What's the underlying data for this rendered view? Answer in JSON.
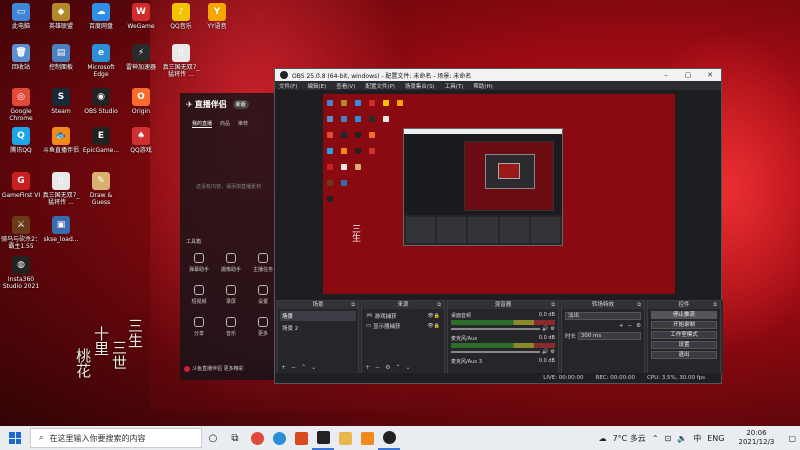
{
  "desktop": {
    "icons": [
      {
        "label": "此电脑",
        "color": "#3f86d6",
        "glyph": "▭"
      },
      {
        "label": "英雄联盟",
        "color": "#b08a2a",
        "glyph": "◆"
      },
      {
        "label": "百度网盘",
        "color": "#2f8fe8",
        "glyph": "☁"
      },
      {
        "label": "WeGame",
        "color": "#d02c2c",
        "glyph": "W"
      },
      {
        "label": "QQ音乐",
        "color": "#f2c300",
        "glyph": "♪"
      },
      {
        "label": "YY语音",
        "color": "#f5a600",
        "glyph": "Y"
      },
      {
        "label": "回收站",
        "color": "#5b8fd0",
        "glyph": "🗑"
      },
      {
        "label": "控制面板",
        "color": "#4a7fc0",
        "glyph": "▤"
      },
      {
        "label": "Microsoft Edge",
        "color": "#2a8fd8",
        "glyph": "e"
      },
      {
        "label": "雷神加速器",
        "color": "#2a2a2a",
        "glyph": "⚡"
      },
      {
        "label": "真三国无双7_猛将传 ...",
        "color": "#e8e8e8",
        "glyph": "▯"
      },
      {
        "label": "Google Chrome",
        "color": "#e04a3a",
        "glyph": "◎"
      },
      {
        "label": "Steam",
        "color": "#1b2838",
        "glyph": "S"
      },
      {
        "label": "OBS Studio",
        "color": "#222",
        "glyph": "◉"
      },
      {
        "label": "Origin",
        "color": "#f56c2d",
        "glyph": "O"
      },
      {
        "label": "腾讯QQ",
        "color": "#1aa6e8",
        "glyph": "Q"
      },
      {
        "label": "斗鱼直播伴侣",
        "color": "#f28a1a",
        "glyph": "🐟"
      },
      {
        "label": "EpicGame...",
        "color": "#222",
        "glyph": "E"
      },
      {
        "label": "QQ游戏",
        "color": "#d03030",
        "glyph": "♠"
      },
      {
        "label": "GameFirst VI",
        "color": "#c82020",
        "glyph": "G"
      },
      {
        "label": "真三国无双7_猛将传 ...",
        "color": "#e8e8e8",
        "glyph": "▯"
      },
      {
        "label": "Draw & Guess",
        "color": "#d8b070",
        "glyph": "✎"
      },
      {
        "label": "骑马与砍杀2：霸主1.55",
        "color": "#6a3a1a",
        "glyph": "⚔"
      },
      {
        "label": "skse_load...",
        "color": "#3a6ab0",
        "glyph": "▣"
      },
      {
        "label": "Insta360 Studio 2021",
        "color": "#222",
        "glyph": "◍"
      }
    ]
  },
  "wallpaper": {
    "calligraphy": [
      "三生",
      "三世",
      "十里",
      "桃花"
    ]
  },
  "cn_app": {
    "logo": "直播伴侣",
    "version_badge": "新版",
    "tabs": [
      "我的直播",
      "商品",
      "推荐"
    ],
    "empty_text": "还没有内容，请添加直播素材",
    "section": "工具箱",
    "tools": [
      "弹幕助手",
      "摄像助手",
      "主播任务",
      "短视频",
      "录屏",
      "设置",
      "分享",
      "音乐",
      "更多"
    ],
    "footer": "斗鱼直播伴侣 更多精彩"
  },
  "obs": {
    "title": "OBS 25.0.8 (64-bit, windows) - 配置文件: 未命名 - 场景: 未命名",
    "menu": [
      "文件(F)",
      "编辑(E)",
      "查看(V)",
      "配置文件(P)",
      "场景集合(S)",
      "工具(T)",
      "帮助(H)"
    ],
    "scenes": {
      "title": "场景",
      "items": [
        "场景",
        "场景 2"
      ]
    },
    "sources": {
      "title": "来源",
      "items": [
        "游戏捕获",
        "显示器捕获"
      ]
    },
    "mixer": {
      "title": "混音器",
      "channels": [
        {
          "name": "桌面音频",
          "db": "0.0 dB"
        },
        {
          "name": "麦克风/Aux",
          "db": "0.0 dB"
        },
        {
          "name": "麦克风/Aux 3",
          "db": "0.0 dB"
        }
      ]
    },
    "transitions": {
      "title": "转场特效",
      "selected": "淡出",
      "duration_label": "时长",
      "duration_value": "300 ms"
    },
    "controls": {
      "title": "控件",
      "buttons": [
        "停止推流",
        "开始录制",
        "工作室模式",
        "设置",
        "退出"
      ]
    },
    "status": {
      "live": "LIVE: 00:00:00",
      "rec": "REC: 00:00:00",
      "cpu": "CPU: 3.5%, 30.00 fps"
    }
  },
  "taskbar": {
    "search_placeholder": "在这里输入你要搜索的内容",
    "weather": "7°C 多云",
    "ime": "中",
    "lang": "ENG",
    "time": "20:06",
    "date": "2021/12/3"
  }
}
